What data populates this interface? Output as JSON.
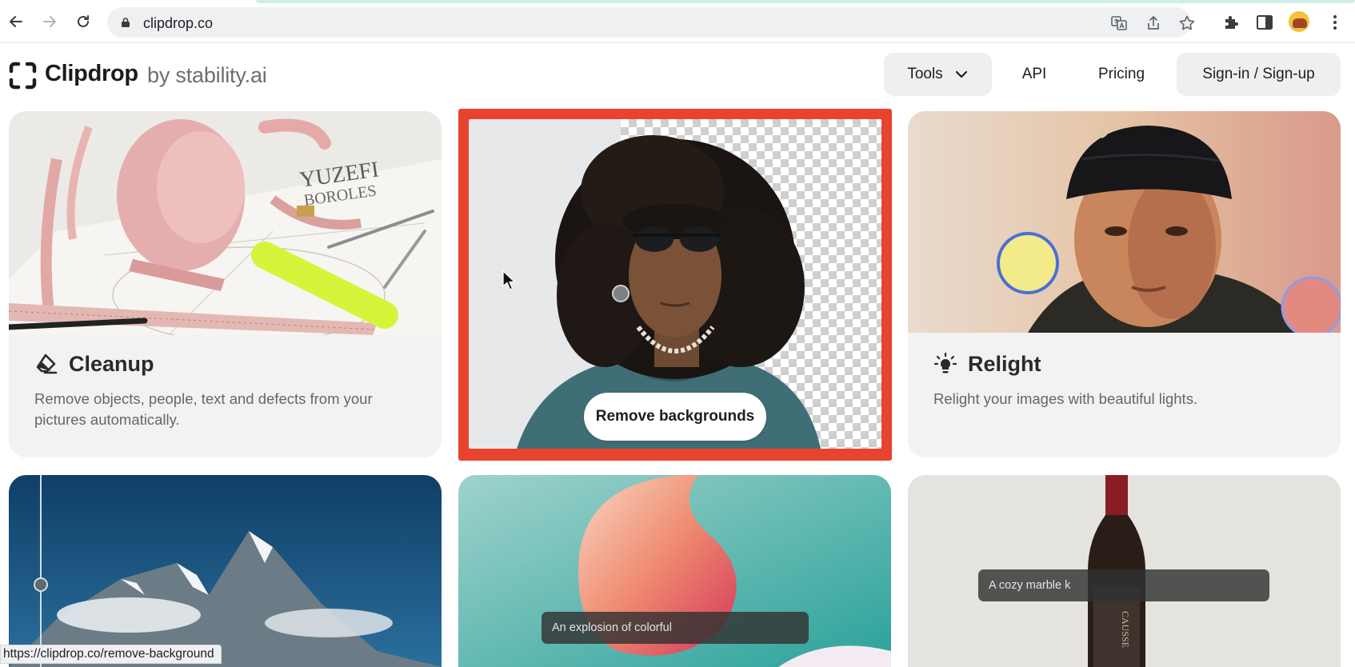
{
  "browser": {
    "url": "clipdrop.co"
  },
  "site": {
    "brand": "Clipdrop",
    "brand_suffix": "by stability.ai",
    "nav": {
      "tools": "Tools",
      "api": "API",
      "pricing": "Pricing",
      "signin": "Sign-in / Sign-up"
    }
  },
  "cards": {
    "cleanup": {
      "title": "Cleanup",
      "desc": "Remove objects, people, text and defects from your pictures automatically.",
      "icon": "eraser-icon"
    },
    "remove_bg": {
      "button": "Remove backgrounds"
    },
    "relight": {
      "title": "Relight",
      "desc": "Relight your images with beautiful lights.",
      "icon": "lightbulb-icon"
    },
    "gradient": {
      "prompt": "An explosion of colorful"
    },
    "wine": {
      "prompt": "A cozy marble k"
    },
    "cleanup_image_text": "YUZEFI\nBOROLES"
  },
  "status_bar": {
    "hover_url": "https://clipdrop.co/remove-background"
  },
  "colors": {
    "highlight": "#e8432e",
    "card_bg": "#f2f2f2",
    "nav_pill_bg": "#efefef"
  }
}
